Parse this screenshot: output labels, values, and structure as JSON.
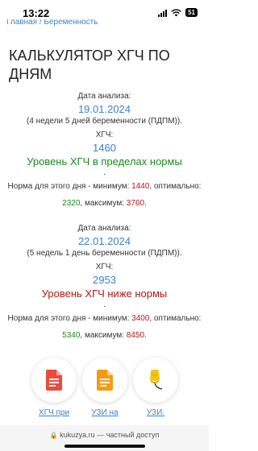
{
  "status": {
    "time": "13:22",
    "battery": "51"
  },
  "breadcrumb": "Главная / Беременность",
  "title": "КАЛЬКУЛЯТОР ХГЧ ПО ДНЯМ",
  "result1": {
    "date_label": "Дата анализа:",
    "date": "19.01.2024",
    "term": "(4 недели 5 дней беременности (ПДПМ)).",
    "hcg_label": "ХГЧ:",
    "hcg": "1460",
    "status": "Уровень ХГЧ в пределах нормы",
    "dot": ".",
    "norm_prefix": "Норма для этого дня - минимум: ",
    "min": "1440",
    "opt_label": ", оптимально:",
    "opt": "2320",
    "max_label": ", максимум: ",
    "max": "3760",
    "end": "."
  },
  "result2": {
    "date_label": "Дата анализа:",
    "date": "22.01.2024",
    "term": "(5 недель 1 день беременности (ПДПМ)).",
    "hcg_label": "ХГЧ:",
    "hcg": "2953",
    "status": "Уровень ХГЧ ниже нормы",
    "dot": ".",
    "norm_prefix": "Норма для этого дня - минимум: ",
    "min": "3400",
    "opt_label": ", оптимально:",
    "opt": "5340",
    "max_label": ", максимум: ",
    "max": "8450",
    "end": "."
  },
  "links": [
    {
      "label": "ХГЧ при",
      "icon": "document-icon",
      "color": "#e74c3c"
    },
    {
      "label": "УЗИ на",
      "icon": "document-icon",
      "color": "#f39c12"
    },
    {
      "label": "УЗИ.",
      "icon": "ultrasound-probe-icon",
      "color": "#f1c40f"
    }
  ],
  "browser": {
    "url": "kukuzya.ru",
    "mode": "— частный доступ"
  }
}
